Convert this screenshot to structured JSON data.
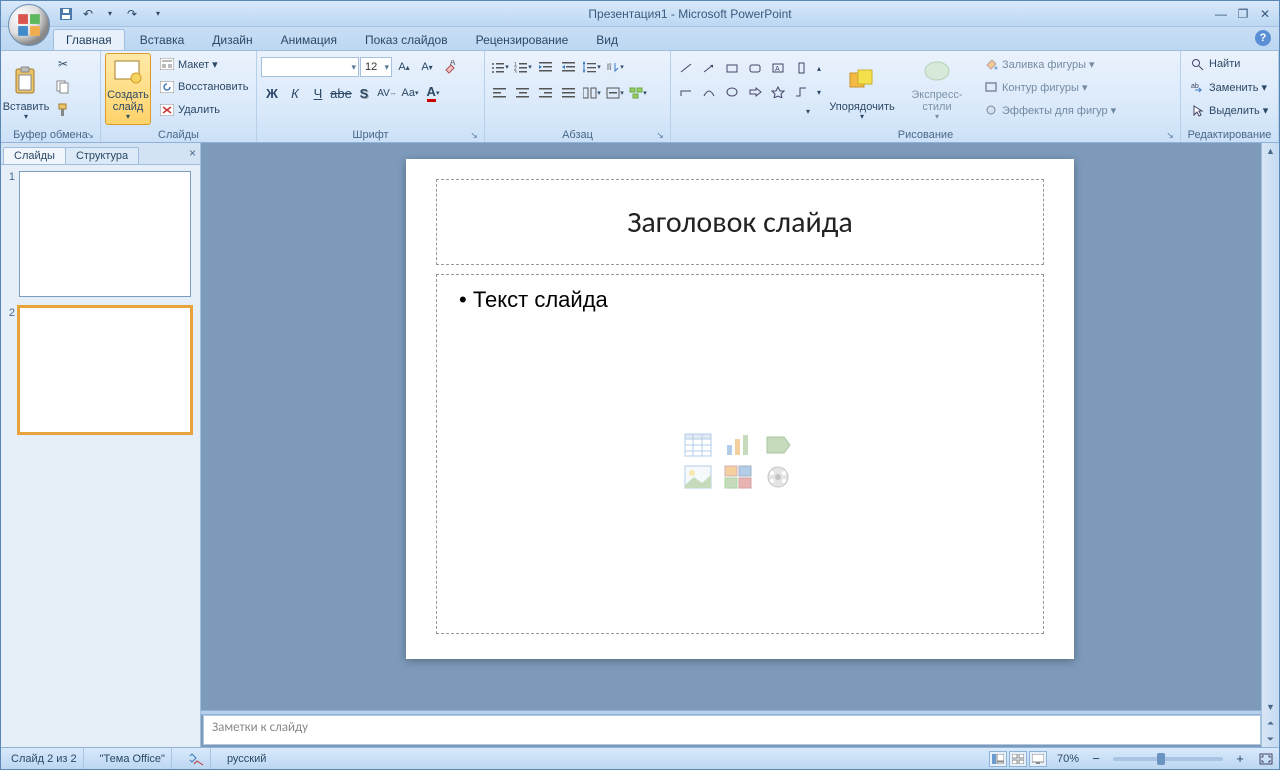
{
  "title": "Презентация1 - Microsoft PowerPoint",
  "tabs": [
    "Главная",
    "Вставка",
    "Дизайн",
    "Анимация",
    "Показ слайдов",
    "Рецензирование",
    "Вид"
  ],
  "active_tab": 0,
  "ribbon": {
    "clipboard": {
      "paste": "Вставить",
      "label": "Буфер обмена"
    },
    "slides": {
      "newSlide": "Создать\nслайд",
      "layout": "Макет ▾",
      "reset": "Восстановить",
      "delete": "Удалить",
      "label": "Слайды"
    },
    "font": {
      "size": "12",
      "label": "Шрифт"
    },
    "paragraph": {
      "label": "Абзац"
    },
    "drawing": {
      "arrange": "Упорядочить",
      "quick": "Экспресс-стили",
      "fill": "Заливка фигуры ▾",
      "outline": "Контур фигуры ▾",
      "effects": "Эффекты для фигур ▾",
      "label": "Рисование"
    },
    "editing": {
      "find": "Найти",
      "replace": "Заменить ▾",
      "select": "Выделить ▾",
      "label": "Редактирование"
    }
  },
  "sidepanel": {
    "tabs": [
      "Слайды",
      "Структура"
    ],
    "slides": [
      1,
      2
    ],
    "selected": 2
  },
  "slide": {
    "title": "Заголовок слайда",
    "body": "Текст слайда"
  },
  "notes_placeholder": "Заметки к слайду",
  "status": {
    "slide": "Слайд 2 из 2",
    "theme": "\"Тема Office\"",
    "lang": "русский",
    "zoom": "70%"
  }
}
